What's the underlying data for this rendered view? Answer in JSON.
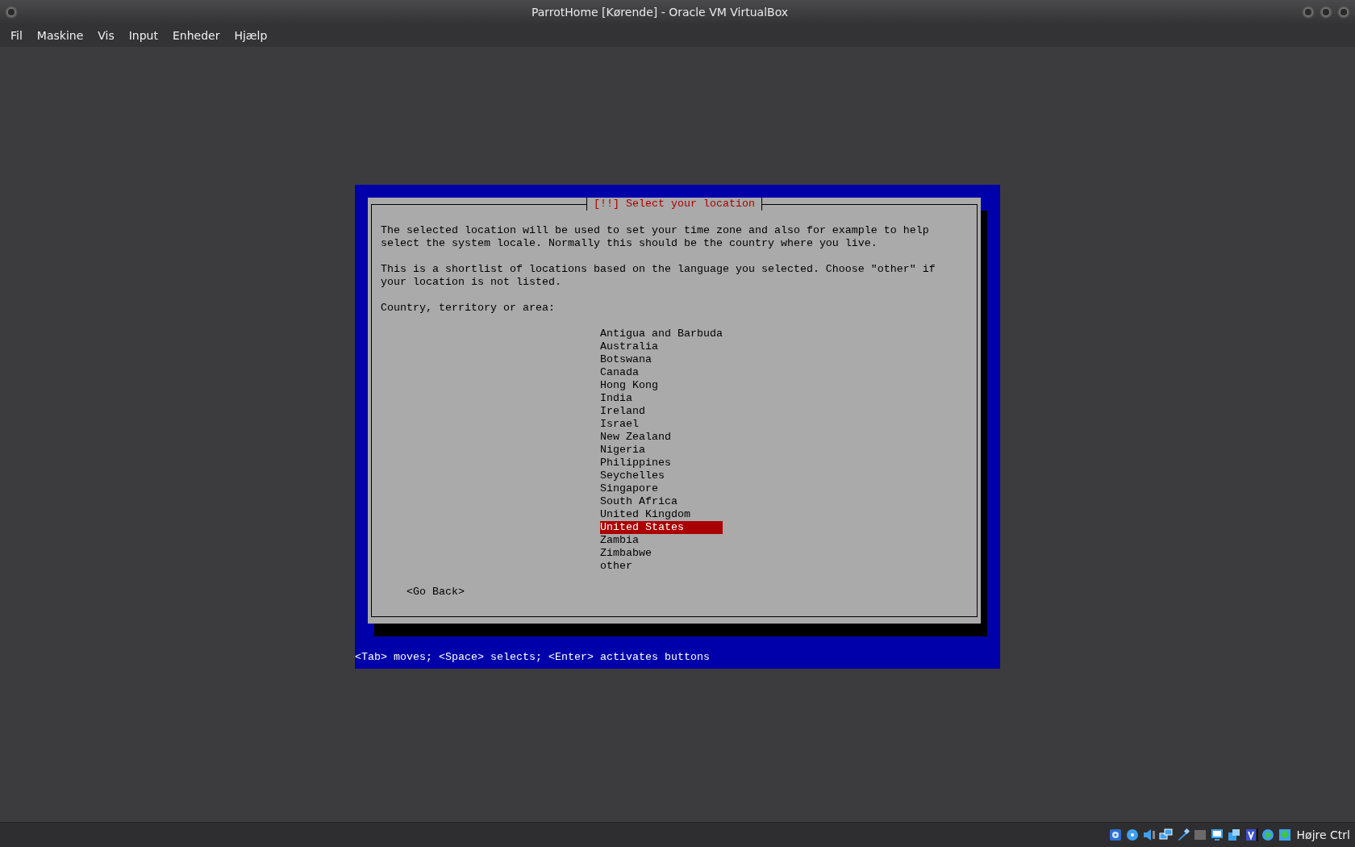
{
  "window": {
    "title": "ParrotHome [Kørende] - Oracle VM VirtualBox"
  },
  "menu": [
    "Fil",
    "Maskine",
    "Vis",
    "Input",
    "Enheder",
    "Hjælp"
  ],
  "installer": {
    "dialog_title": "[!!] Select your location",
    "paragraphs": [
      "The selected location will be used to set your time zone and also for example to help\nselect the system locale. Normally this should be the country where you live.",
      "This is a shortlist of locations based on the language you selected. Choose \"other\" if\nyour location is not listed."
    ],
    "prompt": "Country, territory or area:",
    "locations": [
      {
        "label": "Antigua and Barbuda",
        "selected": false
      },
      {
        "label": "Australia",
        "selected": false
      },
      {
        "label": "Botswana",
        "selected": false
      },
      {
        "label": "Canada",
        "selected": false
      },
      {
        "label": "Hong Kong",
        "selected": false
      },
      {
        "label": "India",
        "selected": false
      },
      {
        "label": "Ireland",
        "selected": false
      },
      {
        "label": "Israel",
        "selected": false
      },
      {
        "label": "New Zealand",
        "selected": false
      },
      {
        "label": "Nigeria",
        "selected": false
      },
      {
        "label": "Philippines",
        "selected": false
      },
      {
        "label": "Seychelles",
        "selected": false
      },
      {
        "label": "Singapore",
        "selected": false
      },
      {
        "label": "South Africa",
        "selected": false
      },
      {
        "label": "United Kingdom",
        "selected": false
      },
      {
        "label": "United States",
        "selected": true
      },
      {
        "label": "Zambia",
        "selected": false
      },
      {
        "label": "Zimbabwe",
        "selected": false
      },
      {
        "label": "other",
        "selected": false
      }
    ],
    "back_button": "<Go Back>",
    "help_line": "<Tab> moves; <Space> selects; <Enter> activates buttons"
  },
  "status_bar": {
    "host_key": "Højre Ctrl"
  }
}
